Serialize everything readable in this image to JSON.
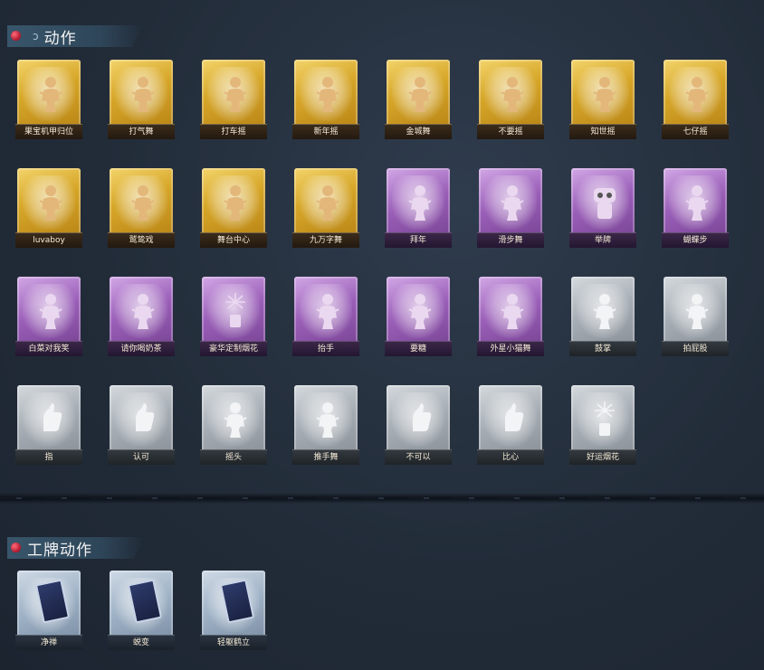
{
  "sections": [
    {
      "title": "动作",
      "items": [
        {
          "label": "果宝机甲归位",
          "rarity": "gold",
          "icon": "figure-icon"
        },
        {
          "label": "打气舞",
          "rarity": "gold",
          "icon": "figure-icon"
        },
        {
          "label": "打车摇",
          "rarity": "gold",
          "icon": "figure-icon"
        },
        {
          "label": "新年摇",
          "rarity": "gold",
          "icon": "figure-icon"
        },
        {
          "label": "金城舞",
          "rarity": "gold",
          "icon": "figure-icon"
        },
        {
          "label": "不要摇",
          "rarity": "gold",
          "icon": "figure-icon"
        },
        {
          "label": "知世摇",
          "rarity": "gold",
          "icon": "figure-icon"
        },
        {
          "label": "七仔摇",
          "rarity": "gold",
          "icon": "figure-icon"
        },
        {
          "label": "luvaboy",
          "rarity": "gold",
          "icon": "figure-icon"
        },
        {
          "label": "鹫鸷戏",
          "rarity": "gold",
          "icon": "figure-icon"
        },
        {
          "label": "舞台中心",
          "rarity": "gold",
          "icon": "figure-icon"
        },
        {
          "label": "九万字舞",
          "rarity": "gold",
          "icon": "figure-icon"
        },
        {
          "label": "拜年",
          "rarity": "purple",
          "icon": "figure-icon"
        },
        {
          "label": "滑步舞",
          "rarity": "purple",
          "icon": "figure-icon"
        },
        {
          "label": "举牌",
          "rarity": "purple",
          "icon": "robot-icon"
        },
        {
          "label": "蝴蝶步",
          "rarity": "purple",
          "icon": "figure-icon"
        },
        {
          "label": "白菜对我笑",
          "rarity": "purple",
          "icon": "figure-icon"
        },
        {
          "label": "请你喝奶茶",
          "rarity": "purple",
          "icon": "figure-icon"
        },
        {
          "label": "豪华定制烟花",
          "rarity": "purple",
          "icon": "fireworks-icon"
        },
        {
          "label": "抬手",
          "rarity": "purple",
          "icon": "figure-icon"
        },
        {
          "label": "要糖",
          "rarity": "purple",
          "icon": "figure-icon"
        },
        {
          "label": "外星小猫舞",
          "rarity": "purple",
          "icon": "figure-icon"
        },
        {
          "label": "鼓掌",
          "rarity": "gray",
          "icon": "figure-icon"
        },
        {
          "label": "拍屁股",
          "rarity": "gray",
          "icon": "figure-icon"
        },
        {
          "label": "指",
          "rarity": "gray",
          "icon": "pointing-hand-icon"
        },
        {
          "label": "认可",
          "rarity": "gray",
          "icon": "thumbs-up-icon"
        },
        {
          "label": "摇头",
          "rarity": "gray",
          "icon": "figure-icon"
        },
        {
          "label": "推手舞",
          "rarity": "gray",
          "icon": "figure-icon"
        },
        {
          "label": "不可以",
          "rarity": "gray",
          "icon": "finger-icon"
        },
        {
          "label": "比心",
          "rarity": "gray",
          "icon": "heart-hand-icon"
        },
        {
          "label": "好运烟花",
          "rarity": "gray",
          "icon": "fireworks-icon"
        }
      ]
    },
    {
      "title": "工牌动作",
      "items": [
        {
          "label": "净禅",
          "rarity": "blue",
          "icon": "tarot-card-icon"
        },
        {
          "label": "蜕变",
          "rarity": "blue",
          "icon": "tarot-card-icon"
        },
        {
          "label": "轻躯鹤立",
          "rarity": "blue",
          "icon": "tarot-card-icon"
        }
      ]
    }
  ]
}
